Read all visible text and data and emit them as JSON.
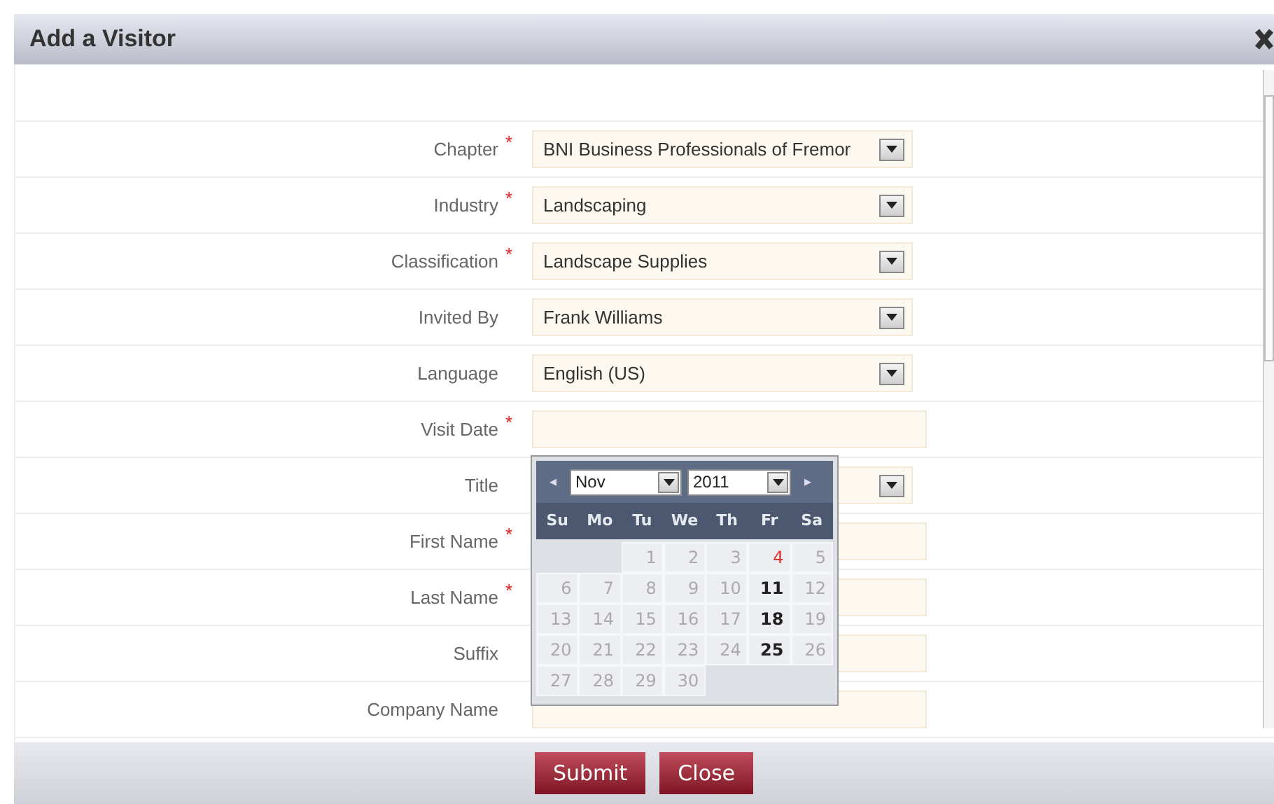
{
  "dialog": {
    "title": "Add a Visitor"
  },
  "fields": [
    {
      "label": "Chapter",
      "required": "*",
      "kind": "select",
      "value": "BNI Business Professionals of Fremor"
    },
    {
      "label": "Industry",
      "required": "*",
      "kind": "select",
      "value": "Landscaping"
    },
    {
      "label": "Classification",
      "required": "*",
      "kind": "select",
      "value": "Landscape Supplies"
    },
    {
      "label": "Invited By",
      "kind": "select",
      "value": "Frank Williams"
    },
    {
      "label": "Language",
      "kind": "select",
      "value": "English (US)"
    },
    {
      "label": "Visit Date",
      "required": "*",
      "kind": "text"
    },
    {
      "label": "Title",
      "kind": "select"
    },
    {
      "label": "First Name",
      "required": "*",
      "kind": "text"
    },
    {
      "label": "Last Name",
      "required": "*",
      "kind": "text"
    },
    {
      "label": "Suffix",
      "kind": "text"
    },
    {
      "label": "Company Name",
      "kind": "text"
    }
  ],
  "calendar": {
    "prev": "◂",
    "next": "▸",
    "month": "Nov",
    "year": "2011",
    "weekdays": [
      "Su",
      "Mo",
      "Tu",
      "We",
      "Th",
      "Fr",
      "Sa"
    ],
    "weeks": [
      [
        {
          "kind": "blank"
        },
        {
          "kind": "blank"
        },
        {
          "day": "1",
          "kind": "disabled"
        },
        {
          "day": "2",
          "kind": "disabled"
        },
        {
          "day": "3",
          "kind": "disabled"
        },
        {
          "day": "4",
          "kind": "hover"
        },
        {
          "day": "5",
          "kind": "disabled"
        }
      ],
      [
        {
          "day": "6",
          "kind": "disabled"
        },
        {
          "day": "7",
          "kind": "disabled"
        },
        {
          "day": "8",
          "kind": "disabled"
        },
        {
          "day": "9",
          "kind": "disabled"
        },
        {
          "day": "10",
          "kind": "disabled"
        },
        {
          "day": "11",
          "kind": "available"
        },
        {
          "day": "12",
          "kind": "disabled"
        }
      ],
      [
        {
          "day": "13",
          "kind": "disabled"
        },
        {
          "day": "14",
          "kind": "disabled"
        },
        {
          "day": "15",
          "kind": "disabled"
        },
        {
          "day": "16",
          "kind": "disabled"
        },
        {
          "day": "17",
          "kind": "disabled"
        },
        {
          "day": "18",
          "kind": "available"
        },
        {
          "day": "19",
          "kind": "disabled"
        }
      ],
      [
        {
          "day": "20",
          "kind": "disabled"
        },
        {
          "day": "21",
          "kind": "disabled"
        },
        {
          "day": "22",
          "kind": "disabled"
        },
        {
          "day": "23",
          "kind": "disabled"
        },
        {
          "day": "24",
          "kind": "disabled"
        },
        {
          "day": "25",
          "kind": "available"
        },
        {
          "day": "26",
          "kind": "disabled"
        }
      ],
      [
        {
          "day": "27",
          "kind": "disabled"
        },
        {
          "day": "28",
          "kind": "disabled"
        },
        {
          "day": "29",
          "kind": "disabled"
        },
        {
          "day": "30",
          "kind": "disabled"
        }
      ]
    ]
  },
  "buttons": [
    "Submit",
    "Close"
  ]
}
